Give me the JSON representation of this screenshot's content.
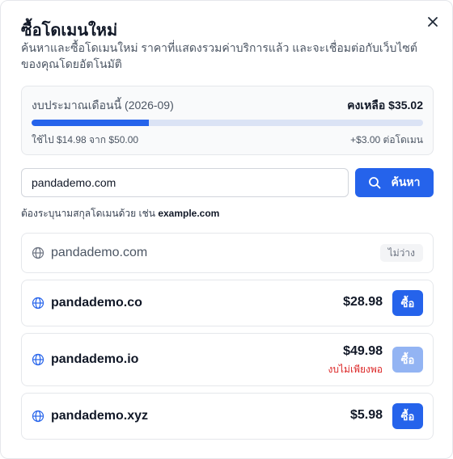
{
  "dialog": {
    "title": "ซื้อโดเมนใหม่",
    "subtitle": "ค้นหาและซื้อโดเมนใหม่ ราคาที่แสดงรวมค่าบริการแล้ว และจะเชื่อมต่อกับเว็บไซต์ของคุณโดยอัตโนมัติ",
    "close_icon": "close-icon"
  },
  "budget": {
    "label": "งบประมาณเดือนนี้ (2026-09)",
    "remaining": "คงเหลือ $35.02",
    "used_text": "ใช้ไป $14.98 จาก $50.00",
    "per_domain": "+$3.00 ต่อโดเมน",
    "used_fraction": 0.2996,
    "colors": {
      "fill": "#2563eb",
      "track": "#dbe3f5"
    }
  },
  "search": {
    "value": "pandademo.com",
    "button_label": "ค้นหา",
    "button_icon": "search-icon"
  },
  "hint": {
    "prefix": "ต้องระบุนามสกุลโดเมนด้วย เช่น",
    "example": "example.com"
  },
  "results": [
    {
      "domain": "pandademo.com",
      "status": "ไม่ว่าง",
      "available": false,
      "icon": "globe-icon"
    },
    {
      "domain": "pandademo.co",
      "price": "$28.98",
      "buy_label": "ซื้อ",
      "available": true,
      "icon": "globe-icon"
    },
    {
      "domain": "pandademo.io",
      "price": "$49.98",
      "warning": "งบไม่เพียงพอ",
      "buy_label": "ซื้อ",
      "available": true,
      "affordable": false,
      "icon": "globe-icon"
    },
    {
      "domain": "pandademo.xyz",
      "price": "$5.98",
      "buy_label": "ซื้อ",
      "available": true,
      "icon": "globe-icon"
    }
  ]
}
